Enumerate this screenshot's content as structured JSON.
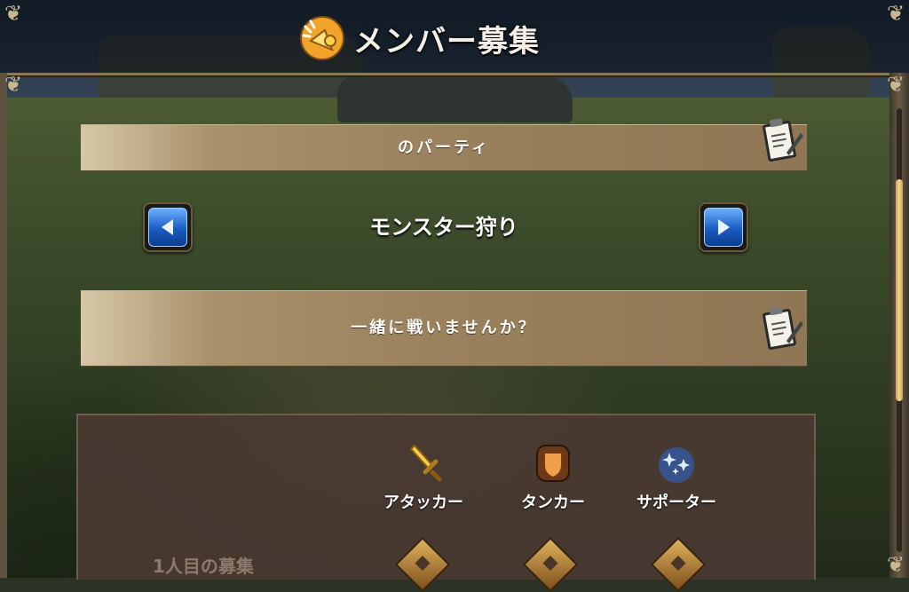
{
  "header": {
    "title": "メンバー募集",
    "icon": "megaphone-icon"
  },
  "party_name_bar": {
    "text": "のパーティ",
    "edit_icon": "clipboard-edit-icon"
  },
  "activity_selector": {
    "value": "モンスター狩り",
    "prev_icon": "arrow-left-icon",
    "next_icon": "arrow-right-icon"
  },
  "message_bar": {
    "text": "一緒に戦いませんか？",
    "edit_icon": "clipboard-edit-icon"
  },
  "roles_panel": {
    "roles": [
      {
        "label": "アタッカー",
        "icon": "sword-icon"
      },
      {
        "label": "タンカー",
        "icon": "shield-icon"
      },
      {
        "label": "サポーター",
        "icon": "sparkle-icon"
      }
    ],
    "member_label": "1人目の募集"
  },
  "colors": {
    "bar_fill": "#a9916c",
    "button_blue": "#1b5cc4",
    "panel_bg": "#4a3a32",
    "frame_gold": "#c9a55a"
  }
}
